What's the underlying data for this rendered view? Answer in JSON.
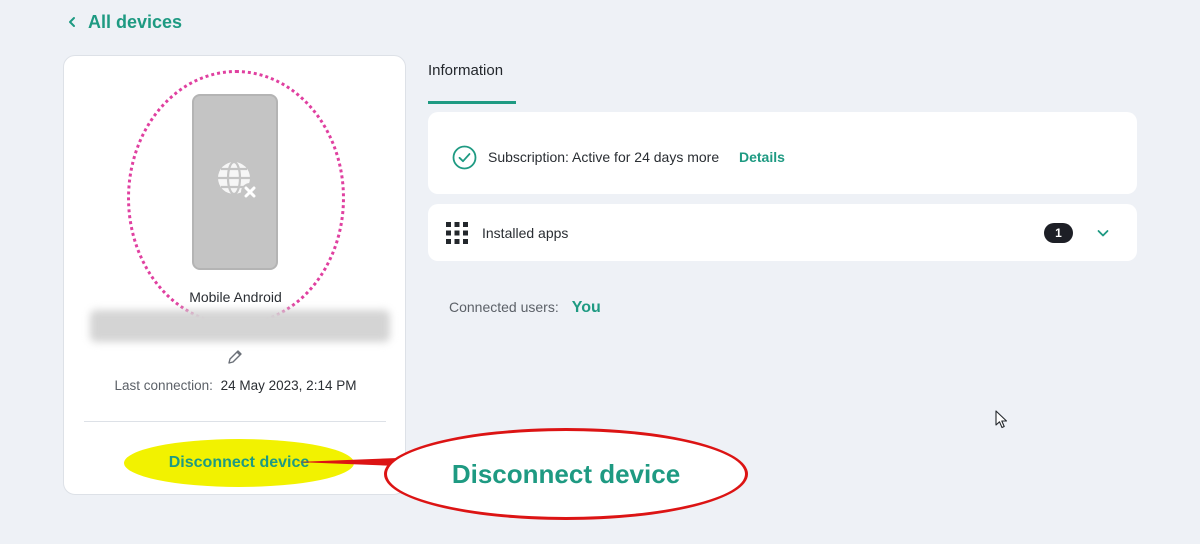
{
  "header": {
    "back_label": "All devices"
  },
  "device": {
    "name": "Mobile Android",
    "last_connection_label": "Last connection:",
    "last_connection_value": "24 May 2023, 2:14 PM",
    "disconnect_label": "Disconnect device"
  },
  "tabs": [
    {
      "label": "Information",
      "active": true
    }
  ],
  "subscription": {
    "text": "Subscription: Active for 24 days more",
    "details_label": "Details"
  },
  "installed_apps": {
    "label": "Installed apps",
    "count": "1"
  },
  "connected_users": {
    "label": "Connected users:",
    "value": "You"
  },
  "annotation": {
    "callout_text": "Disconnect device"
  },
  "icons": {
    "back": "chevron-left-icon",
    "phone": "phone-offline-icon",
    "edit": "pencil-icon",
    "check": "check-circle-icon",
    "apps": "grid-icon",
    "expand": "chevron-down-icon",
    "cursor": "mouse-pointer-icon"
  },
  "colors": {
    "accent": "#1e9a82",
    "background": "#eef1f6",
    "callout_border": "#dc1414",
    "highlight_yellow": "#f2f200",
    "highlight_pink": "#e040a0"
  }
}
